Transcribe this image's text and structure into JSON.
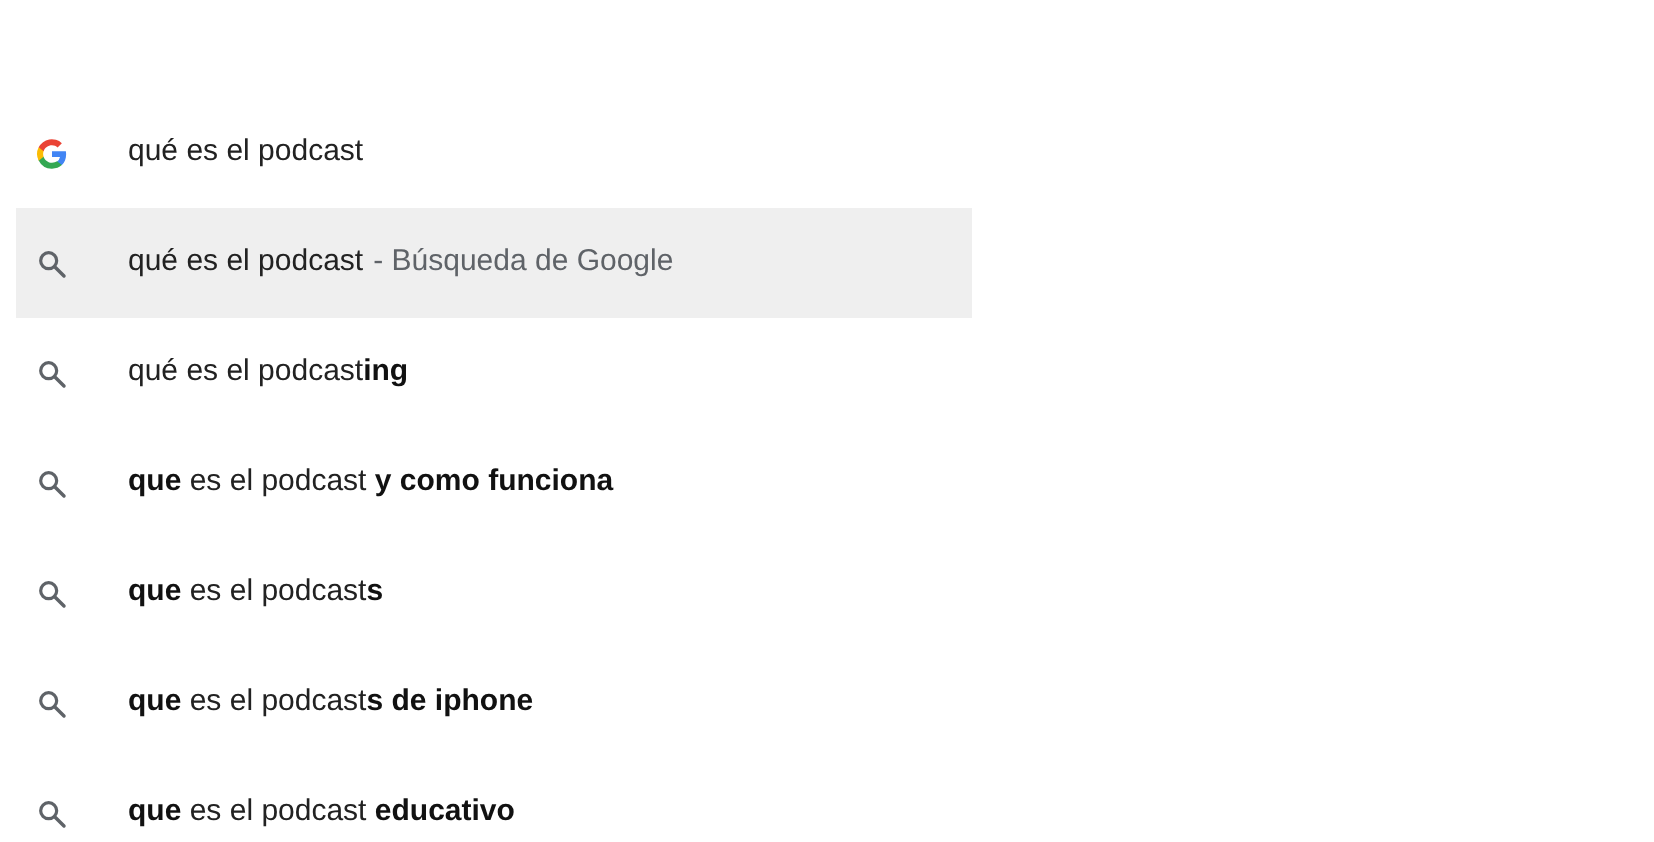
{
  "suggestions": [
    {
      "kind": "google",
      "text": "qué es el podcast",
      "selected": false
    },
    {
      "kind": "search",
      "text": "qué es el podcast",
      "suffix": "- Búsqueda de Google",
      "selected": true
    },
    {
      "kind": "search",
      "text": "qué es el podcast**ing**",
      "selected": false
    },
    {
      "kind": "search",
      "text": "**que** es el podcast **y como funciona**",
      "selected": false
    },
    {
      "kind": "search",
      "text": "**que** es el podcast**s**",
      "selected": false
    },
    {
      "kind": "search",
      "text": "**que** es el podcast**s de iphone**",
      "selected": false
    },
    {
      "kind": "search",
      "text": "**que** es el podcast **educativo**",
      "selected": false
    }
  ]
}
